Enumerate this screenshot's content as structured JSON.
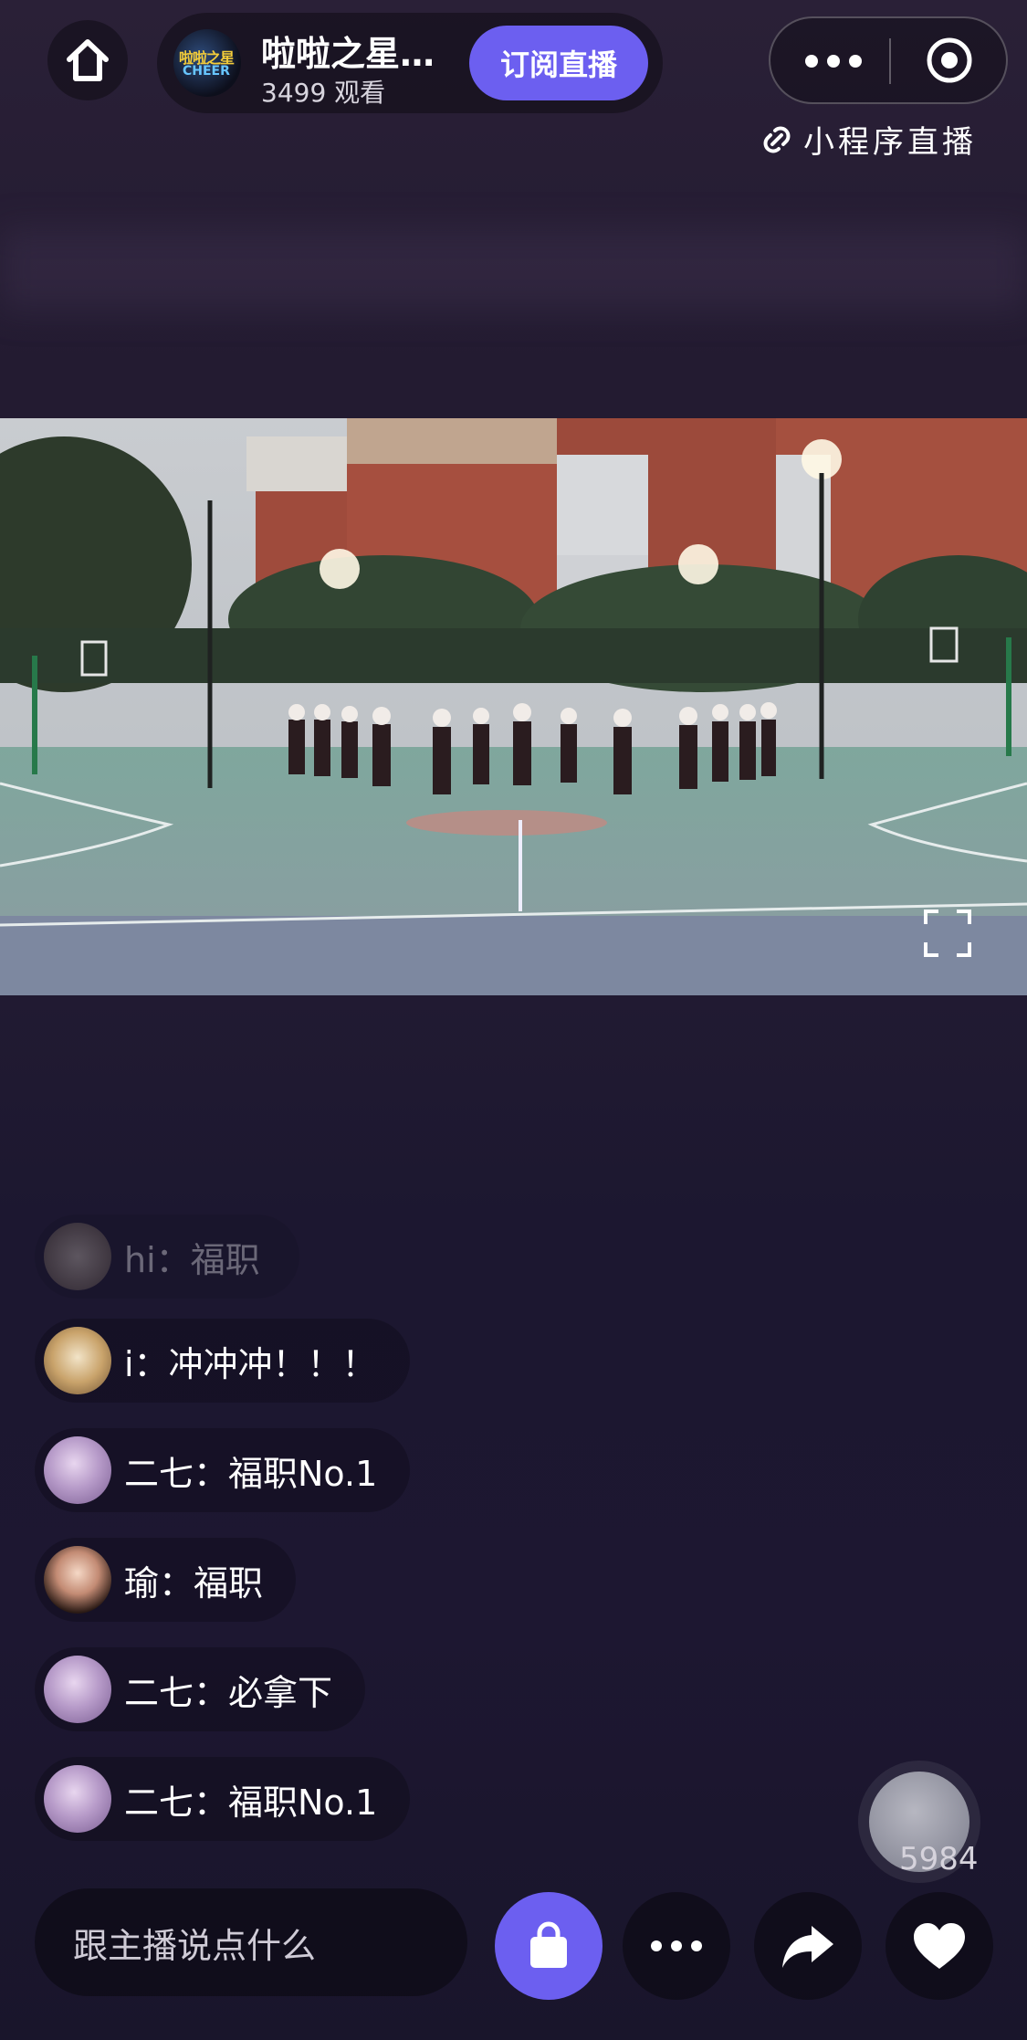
{
  "header": {
    "anchor_name": "啦啦之星…",
    "viewers": "3499 观看",
    "subscribe_label": "订阅直播",
    "mini_program_label": "小程序直播",
    "avatar_logo_top": "啦啦之星",
    "avatar_logo_bottom": "CHEER"
  },
  "comments": [
    {
      "user": "hi",
      "text": "hi：福职",
      "faded": true
    },
    {
      "user": "i",
      "text": "i：冲冲冲！！！"
    },
    {
      "user": "二七",
      "text": "二七：福职No.1"
    },
    {
      "user": "瑜",
      "text": "瑜：福职"
    },
    {
      "user": "二七",
      "text": "二七：必拿下"
    },
    {
      "user": "二七",
      "text": "二七：福职No.1"
    }
  ],
  "bottom": {
    "input_placeholder": "跟主播说点什么",
    "like_count": "5984"
  },
  "colors": {
    "accent": "#6c5ff0",
    "background": "#231b31"
  },
  "icons": [
    "home-icon",
    "more-dots-icon",
    "close-circle-icon",
    "link-icon",
    "fullscreen-icon",
    "shopping-bag-icon",
    "share-arrow-icon",
    "heart-icon"
  ]
}
